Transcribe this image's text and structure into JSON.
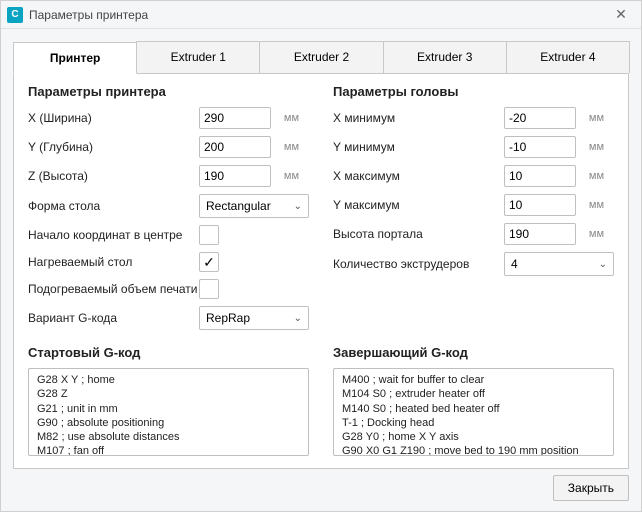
{
  "window": {
    "title": "Параметры принтера"
  },
  "tabs": [
    {
      "label": "Принтер",
      "active": true
    },
    {
      "label": "Extruder 1",
      "active": false
    },
    {
      "label": "Extruder 2",
      "active": false
    },
    {
      "label": "Extruder 3",
      "active": false
    },
    {
      "label": "Extruder 4",
      "active": false
    }
  ],
  "printer_section": {
    "title": "Параметры принтера",
    "x_label": "X (Ширина)",
    "x_value": "290",
    "x_unit": "мм",
    "y_label": "Y (Глубина)",
    "y_value": "200",
    "y_unit": "мм",
    "z_label": "Z (Высота)",
    "z_value": "190",
    "z_unit": "мм",
    "shape_label": "Форма стола",
    "shape_value": "Rectangular",
    "origin_label": "Начало координат в центре",
    "origin_checked": false,
    "heated_bed_label": "Нагреваемый стол",
    "heated_bed_checked": true,
    "heated_volume_label": "Подогреваемый объем печати",
    "heated_volume_checked": false,
    "gcode_flavor_label": "Вариант G-кода",
    "gcode_flavor_value": "RepRap"
  },
  "head_section": {
    "title": "Параметры головы",
    "xmin_label": "X минимум",
    "xmin_value": "-20",
    "xmin_unit": "мм",
    "ymin_label": "Y минимум",
    "ymin_value": "-10",
    "ymin_unit": "мм",
    "xmax_label": "X максимум",
    "xmax_value": "10",
    "xmax_unit": "мм",
    "ymax_label": "Y максимум",
    "ymax_value": "10",
    "ymax_unit": "мм",
    "gantry_label": "Высота портала",
    "gantry_value": "190",
    "gantry_unit": "мм",
    "extruders_label": "Количество экструдеров",
    "extruders_value": "4"
  },
  "start_gcode": {
    "title": "Стартовый G-код",
    "text": "G28 X Y ; home\nG28 Z\nG21 ; unit in mm\nG90 ; absolute positioning\nM82 ; use absolute distances\nM107 ; fan off"
  },
  "end_gcode": {
    "title": "Завершающий G-код",
    "text": "M400 ; wait for buffer to clear\nM104 S0 ; extruder heater off\nM140 S0 ; heated bed heater off\nT-1 ; Docking head\nG28 Y0 ; home X Y axis\nG90 X0 G1 Z190 ; move bed to 190 mm position"
  },
  "footer": {
    "close": "Закрыть"
  }
}
